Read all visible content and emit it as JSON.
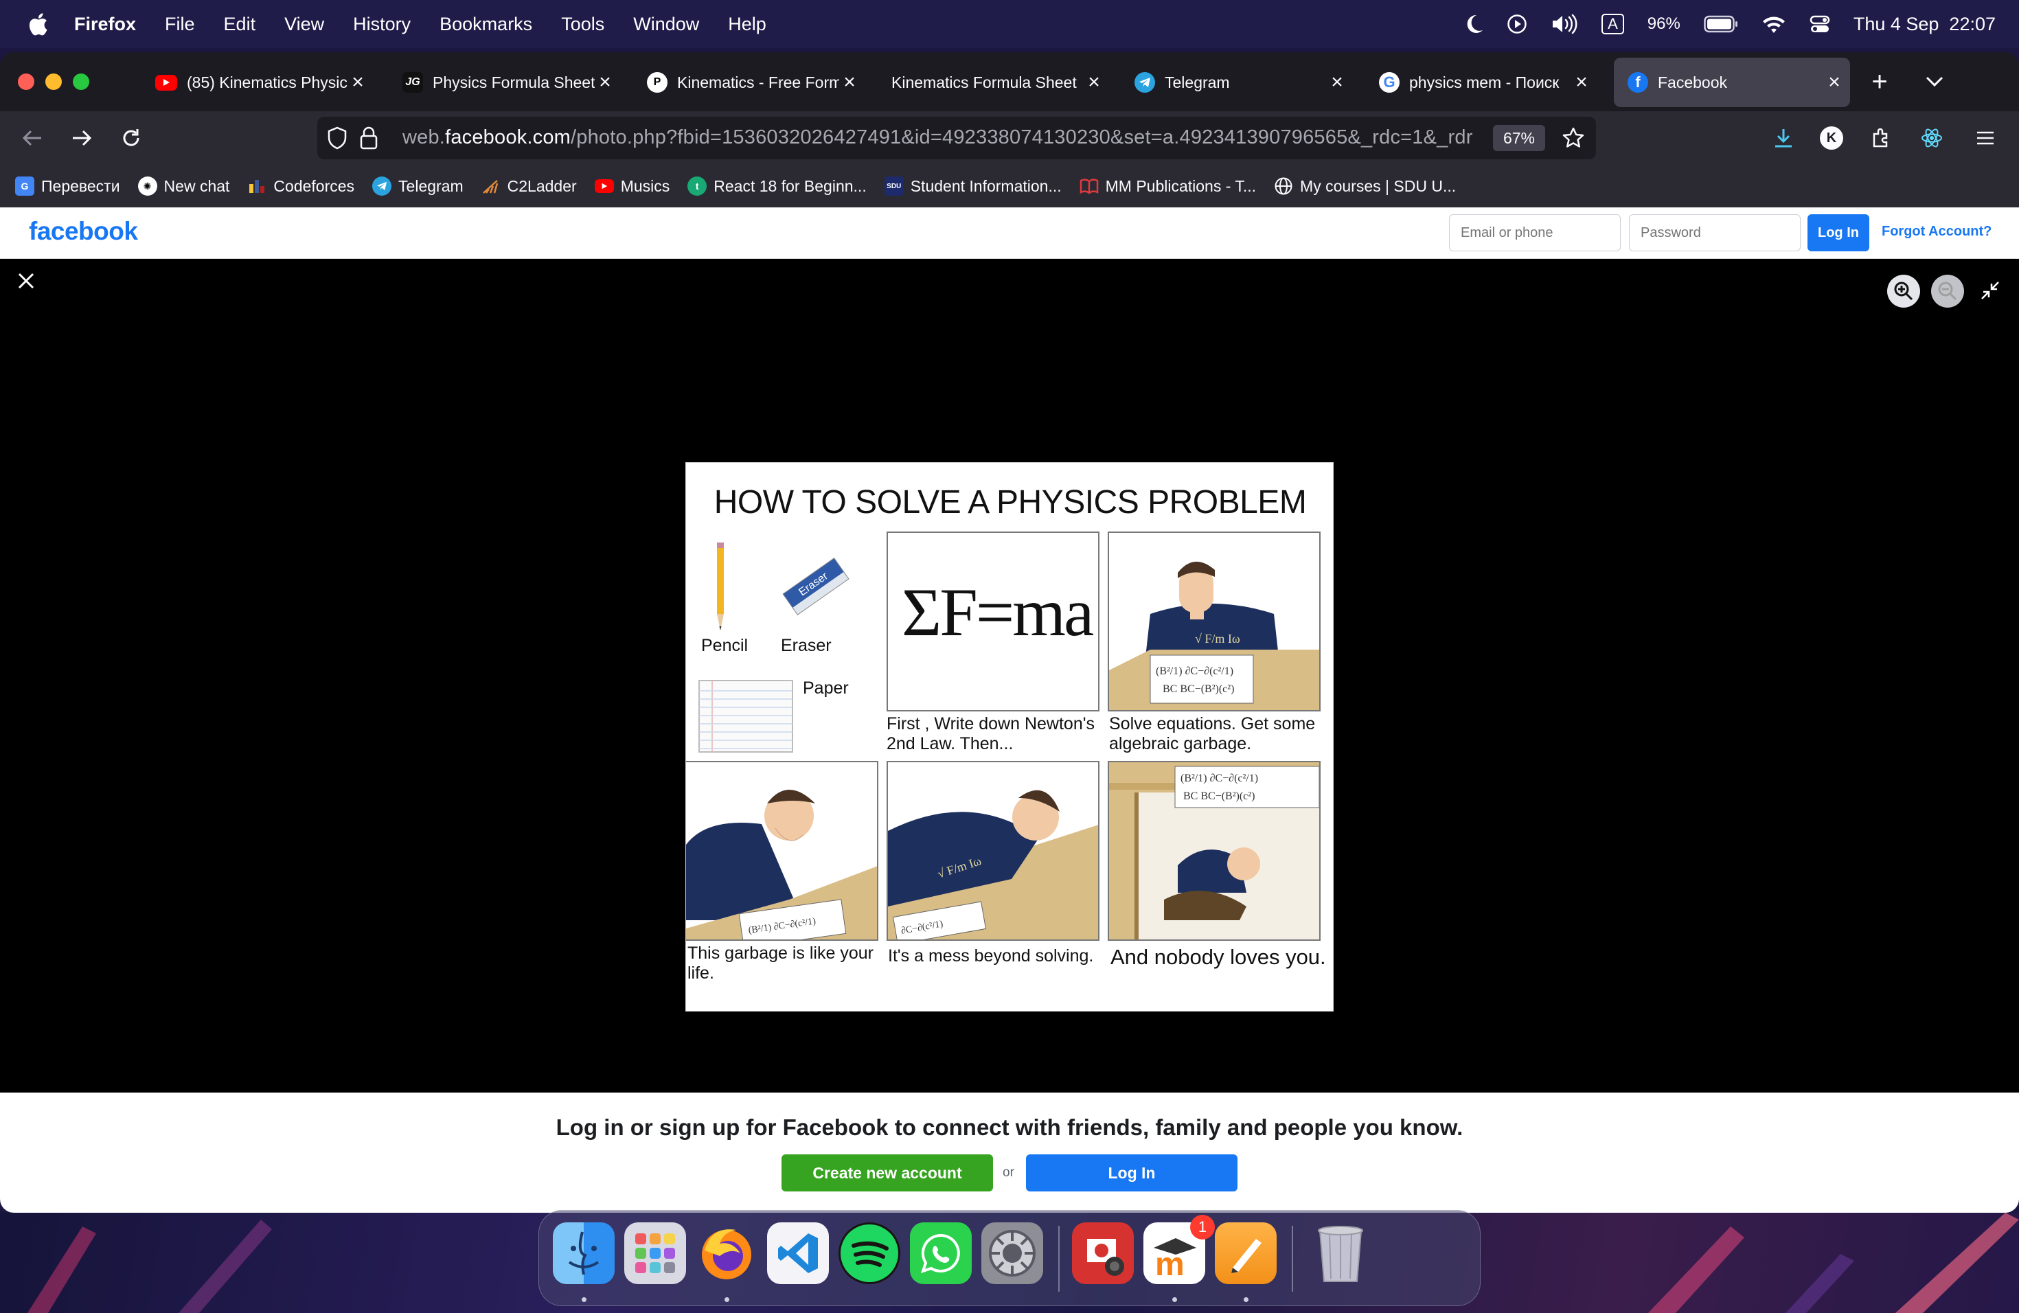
{
  "menubar": {
    "app": "Firefox",
    "items": [
      "File",
      "Edit",
      "View",
      "History",
      "Bookmarks",
      "Tools",
      "Window",
      "Help"
    ],
    "input_source": "A",
    "battery": "96%",
    "datetime": "Thu 4 Sep  22:07"
  },
  "tabs": [
    {
      "title": "(85) Kinematics Physic",
      "icon": "youtube-icon"
    },
    {
      "title": "Physics Formula Sheet",
      "icon": "jg-icon"
    },
    {
      "title": "Kinematics - Free Form",
      "icon": "notion-icon"
    },
    {
      "title": "Kinematics Formula Sheet",
      "icon": "none"
    },
    {
      "title": "Telegram",
      "icon": "telegram-icon"
    },
    {
      "title": "physics mem - Поиск",
      "icon": "google-icon"
    },
    {
      "title": "Facebook",
      "icon": "facebook-icon",
      "active": true
    }
  ],
  "navbar": {
    "url_prefix": "web.",
    "url_domain": "facebook.com",
    "url_path": "/photo.php?fbid=1536032026427491&id=492338074130230&set=a.492341390796565&_rdc=1&_rdr",
    "zoom": "67%",
    "profile_initial": "K"
  },
  "bookmarks": [
    {
      "label": "Перевести",
      "icon": "translate-icon"
    },
    {
      "label": "New chat",
      "icon": "openai-icon"
    },
    {
      "label": "Codeforces",
      "icon": "codeforces-icon"
    },
    {
      "label": "Telegram",
      "icon": "telegram-icon"
    },
    {
      "label": "C2Ladder",
      "icon": "c2ladder-icon"
    },
    {
      "label": "Musics",
      "icon": "youtube-icon"
    },
    {
      "label": "React 18 for Beginn...",
      "icon": "t-icon"
    },
    {
      "label": "Student Information...",
      "icon": "sdu-icon"
    },
    {
      "label": "MM Publications - T...",
      "icon": "book-icon"
    },
    {
      "label": "My courses | SDU U...",
      "icon": "globe-icon"
    }
  ],
  "facebook": {
    "logo": "facebook",
    "email_placeholder": "Email or phone",
    "password_placeholder": "Password",
    "login_label": "Log In",
    "forgot_label": "Forgot Account?",
    "footer_text": "Log in or sign up for Facebook to connect with friends, family and people you know.",
    "create_label": "Create new account",
    "or_label": "or",
    "footer_login_label": "Log In"
  },
  "meme": {
    "title": "HOW TO SOLVE A PHYSICS PROBLEM",
    "pencil": "Pencil",
    "eraser": "Eraser",
    "eraser_brand": "Eraser",
    "paper": "Paper",
    "formula": "ΣF=ma",
    "cap2": "First , Write down Newton's 2nd Law. Then...",
    "cap3": "Solve equations. Get some algebraic garbage.",
    "cap4": "This garbage is like your life.",
    "cap5": "It's a mess beyond solving.",
    "cap6": "And nobody loves you."
  },
  "dock": {
    "apps": [
      "Finder",
      "Launchpad",
      "Firefox",
      "Visual Studio Code",
      "Spotify",
      "WhatsApp",
      "System Settings",
      "Photo Booth",
      "Moodle",
      "Pages",
      "Trash"
    ],
    "moodle_badge": "1"
  }
}
